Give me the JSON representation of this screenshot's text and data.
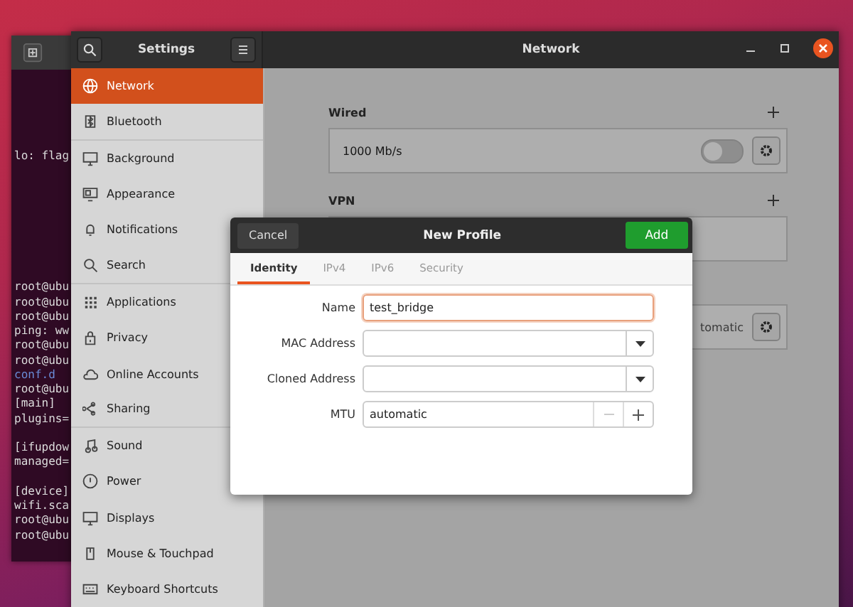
{
  "terminal": {
    "lines": [
      {
        "text": "lo: flag",
        "kind": "plain"
      },
      {
        "kind": "blank"
      },
      {
        "kind": "blank"
      },
      {
        "kind": "blank"
      },
      {
        "kind": "blank"
      },
      {
        "kind": "blank"
      },
      {
        "kind": "blank"
      },
      {
        "kind": "blank"
      },
      {
        "kind": "blank"
      },
      {
        "text": "root@ubu",
        "kind": "plain"
      },
      {
        "text": "root@ubu",
        "kind": "plain"
      },
      {
        "text": "root@ubu",
        "kind": "plain"
      },
      {
        "text": "ping: ww",
        "kind": "plain"
      },
      {
        "text": "root@ubu",
        "kind": "plain"
      },
      {
        "text": "root@ubu",
        "kind": "plain"
      },
      {
        "text": "conf.d",
        "kind": "dir"
      },
      {
        "text": "root@ubu",
        "kind": "plain"
      },
      {
        "text": "[main]",
        "kind": "plain"
      },
      {
        "text": "plugins=",
        "kind": "plain"
      },
      {
        "kind": "blank"
      },
      {
        "text": "[ifupdow",
        "kind": "plain"
      },
      {
        "text": "managed=",
        "kind": "plain"
      },
      {
        "kind": "blank"
      },
      {
        "text": "[device]",
        "kind": "plain"
      },
      {
        "text": "wifi.sca",
        "kind": "plain"
      },
      {
        "text": "root@ubu",
        "kind": "plain"
      },
      {
        "text": "root@ubu",
        "kind": "plain"
      }
    ]
  },
  "settings": {
    "sidebar_title": "Settings",
    "title": "Network",
    "sidebar": [
      {
        "label": "Network",
        "selected": true
      },
      {
        "label": "Bluetooth",
        "selected": false
      },
      {
        "label": "Background",
        "selected": false
      },
      {
        "label": "Appearance",
        "selected": false
      },
      {
        "label": "Notifications",
        "selected": false
      },
      {
        "label": "Search",
        "selected": false
      },
      {
        "label": "Applications",
        "selected": false
      },
      {
        "label": "Privacy",
        "selected": false
      },
      {
        "label": "Online Accounts",
        "selected": false
      },
      {
        "label": "Sharing",
        "selected": false
      },
      {
        "label": "Sound",
        "selected": false
      },
      {
        "label": "Power",
        "selected": false
      },
      {
        "label": "Displays",
        "selected": false
      },
      {
        "label": "Mouse & Touchpad",
        "selected": false
      },
      {
        "label": "Keyboard Shortcuts",
        "selected": false
      }
    ],
    "sections": [
      {
        "heading": "Wired",
        "rows": [
          {
            "kind": "toggle",
            "label": "1000 Mb/s",
            "on": false
          }
        ]
      },
      {
        "heading": "VPN",
        "rows": [
          {
            "kind": "empty"
          }
        ]
      },
      {
        "rows": [
          {
            "kind": "status",
            "status": "tomatic"
          }
        ]
      }
    ]
  },
  "dialog": {
    "cancel": "Cancel",
    "title": "New Profile",
    "add": "Add",
    "tabs": [
      {
        "label": "Identity",
        "selected": true
      },
      {
        "label": "IPv4",
        "selected": false
      },
      {
        "label": "IPv6",
        "selected": false
      },
      {
        "label": "Security",
        "selected": false
      }
    ],
    "fields": [
      {
        "label": "Name",
        "kind": "text",
        "value": "test_bridge",
        "focused": true
      },
      {
        "label": "MAC Address",
        "kind": "dropdown",
        "focused": false
      },
      {
        "label": "Cloned Address",
        "kind": "dropdown",
        "focused": false
      },
      {
        "label": "MTU",
        "kind": "spin",
        "value": "automatic",
        "focused": false
      }
    ]
  }
}
